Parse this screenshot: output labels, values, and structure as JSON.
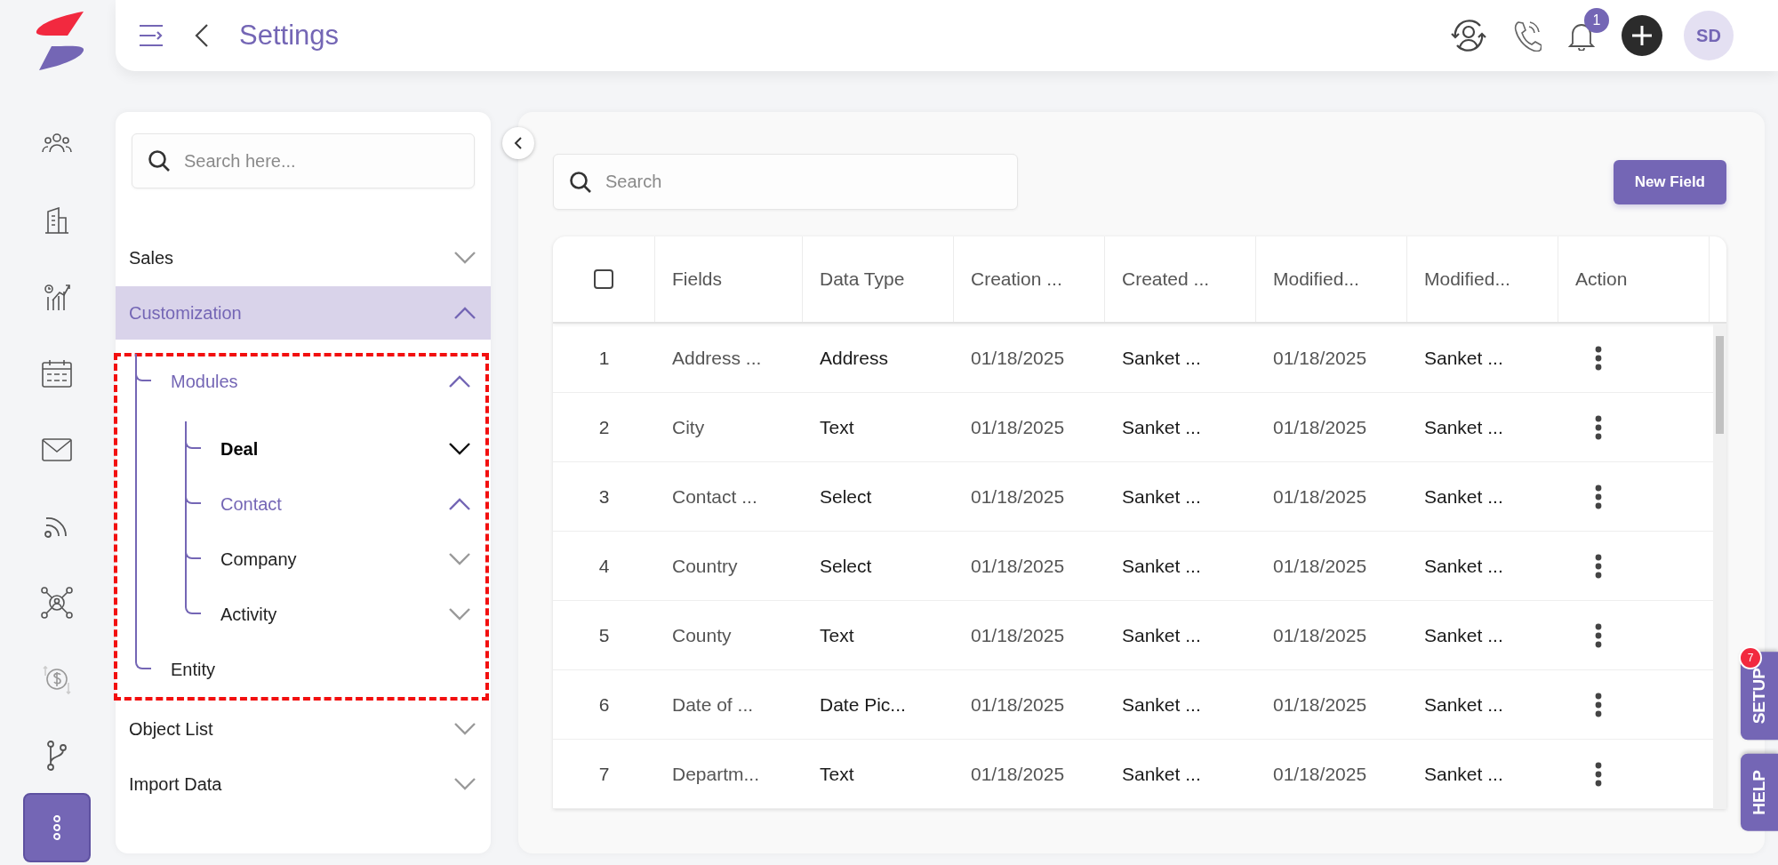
{
  "rail": {
    "items": [
      {
        "selected": false
      },
      {
        "selected": false
      },
      {
        "selected": false
      },
      {
        "selected": false
      },
      {
        "selected": false
      },
      {
        "selected": false
      },
      {
        "selected": false
      },
      {
        "selected": false
      },
      {
        "selected": false
      },
      {
        "selected": true
      }
    ]
  },
  "header": {
    "title": "Settings",
    "notification_count": "1",
    "avatar_initials": "SD"
  },
  "sidebar": {
    "search": {
      "placeholder": "Search here..."
    },
    "items": [
      {
        "label": "Sales",
        "kind": "group",
        "expanded": false,
        "selected": false,
        "highlighted": false,
        "annotated": false
      },
      {
        "label": "Customization",
        "kind": "group",
        "expanded": true,
        "selected": true,
        "highlighted": false,
        "annotated": true,
        "children": [
          {
            "label": "Modules",
            "kind": "group",
            "expanded": true,
            "selected": true,
            "highlighted": false,
            "children": [
              {
                "label": "Deal",
                "kind": "group",
                "expanded": false,
                "selected": false,
                "highlighted": true
              },
              {
                "label": "Contact",
                "kind": "group",
                "expanded": true,
                "selected": true,
                "highlighted": false
              },
              {
                "label": "Company",
                "kind": "group",
                "expanded": false,
                "selected": false,
                "highlighted": false
              },
              {
                "label": "Activity",
                "kind": "group",
                "expanded": false,
                "selected": false,
                "highlighted": false
              }
            ]
          },
          {
            "label": "Entity",
            "kind": "leaf",
            "selected": false,
            "highlighted": false
          }
        ]
      },
      {
        "label": "Object List",
        "kind": "group",
        "expanded": false,
        "selected": false,
        "highlighted": false,
        "annotated": false
      },
      {
        "label": "Import Data",
        "kind": "group",
        "expanded": false,
        "selected": false,
        "highlighted": false,
        "annotated": false
      }
    ]
  },
  "main": {
    "search": {
      "placeholder": "Search"
    },
    "new_button": "New Field",
    "table": {
      "select_all": {
        "checked": false
      },
      "columns": [
        "",
        "Fields",
        "Data Type",
        "Creation ...",
        "Created ...",
        "Modified...",
        "Modified...",
        "Action"
      ],
      "rows": [
        {
          "cells": [
            "1",
            "Address ...",
            "Address",
            "01/18/2025",
            "Sanket ...",
            "01/18/2025",
            "Sanket ...",
            ""
          ]
        },
        {
          "cells": [
            "2",
            "City",
            "Text",
            "01/18/2025",
            "Sanket ...",
            "01/18/2025",
            "Sanket ...",
            ""
          ]
        },
        {
          "cells": [
            "3",
            "Contact ...",
            "Select",
            "01/18/2025",
            "Sanket ...",
            "01/18/2025",
            "Sanket ...",
            ""
          ]
        },
        {
          "cells": [
            "4",
            "Country",
            "Select",
            "01/18/2025",
            "Sanket ...",
            "01/18/2025",
            "Sanket ...",
            ""
          ]
        },
        {
          "cells": [
            "5",
            "County",
            "Text",
            "01/18/2025",
            "Sanket ...",
            "01/18/2025",
            "Sanket ...",
            ""
          ]
        },
        {
          "cells": [
            "6",
            "Date of ...",
            "Date Pic...",
            "01/18/2025",
            "Sanket ...",
            "01/18/2025",
            "Sanket ...",
            ""
          ]
        },
        {
          "cells": [
            "7",
            "Departm...",
            "Text",
            "01/18/2025",
            "Sanket ...",
            "01/18/2025",
            "Sanket ...",
            ""
          ]
        }
      ]
    }
  },
  "side_tabs": [
    {
      "label": "SETUP",
      "badge": "7"
    },
    {
      "label": "HELP"
    }
  ]
}
